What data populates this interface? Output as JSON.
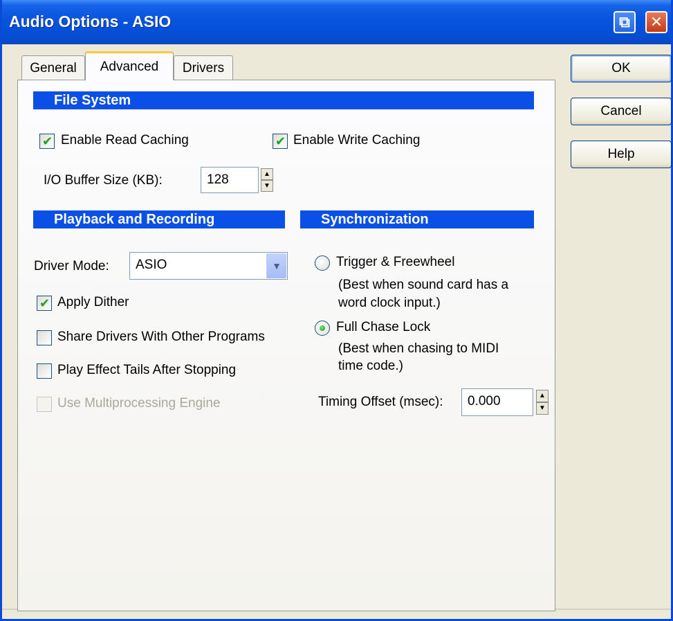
{
  "window": {
    "title": "Audio Options - ASIO",
    "restore_glyph": "⧉",
    "close_glyph": "✕"
  },
  "tabs": [
    {
      "label": "General",
      "active": false
    },
    {
      "label": "Advanced",
      "active": true
    },
    {
      "label": "Drivers",
      "active": false
    }
  ],
  "buttons": {
    "ok": "OK",
    "cancel": "Cancel",
    "help": "Help"
  },
  "file_system": {
    "header": "File System",
    "enable_read_caching": {
      "label": "Enable Read Caching",
      "checked": true
    },
    "enable_write_caching": {
      "label": "Enable Write Caching",
      "checked": true
    },
    "io_buffer_label": "I/O Buffer Size (KB):",
    "io_buffer_value": "128"
  },
  "playback": {
    "header": "Playback and Recording",
    "driver_mode_label": "Driver Mode:",
    "driver_mode_value": "ASIO",
    "apply_dither": {
      "label": "Apply Dither",
      "checked": true
    },
    "share_drivers": {
      "label": "Share Drivers With Other Programs",
      "checked": false
    },
    "play_effect_tails": {
      "label": "Play Effect Tails After Stopping",
      "checked": false
    },
    "use_multiprocessing": {
      "label": "Use Multiprocessing Engine",
      "checked": false,
      "disabled": true
    }
  },
  "synchronization": {
    "header": "Synchronization",
    "trigger_freewheel": {
      "label": "Trigger & Freewheel",
      "selected": false
    },
    "trigger_desc_1": "(Best when sound card has a",
    "trigger_desc_2": "word clock input.)",
    "full_chase_lock": {
      "label": "Full Chase Lock",
      "selected": true
    },
    "chase_desc_1": "(Best when chasing to MIDI",
    "chase_desc_2": "time code.)",
    "timing_offset_label": "Timing Offset (msec):",
    "timing_offset_value": "0.000"
  },
  "spinner": {
    "up": "▲",
    "down": "▼"
  },
  "select_arrow": "▼",
  "check_mark": "✔",
  "colors": {
    "title_bar": "#0a55e0",
    "section_header": "#0a50e6",
    "tab_highlight": "#ffc83c",
    "check_green": "#21a121"
  }
}
